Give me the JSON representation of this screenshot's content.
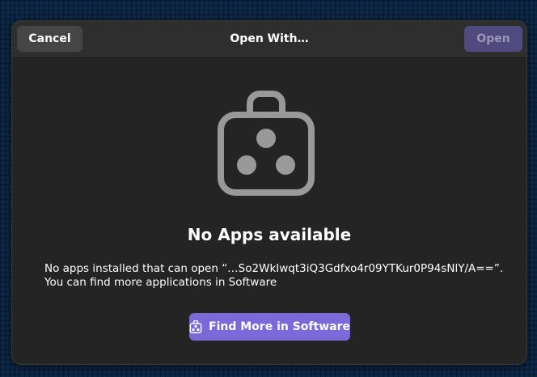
{
  "dialog": {
    "title": "Open With…",
    "cancel_label": "Cancel",
    "open_label": "Open",
    "heading": "No Apps available",
    "message_line1": "No apps installed that can open “…So2WkIwqt3iQ3Gdfxo4r09YTKur0P94sNlY/A==”.",
    "message_line2": "You can find more applications in Software",
    "find_button_label": "Find More in Software"
  },
  "icons": {
    "large": "software-bag-icon",
    "button": "software-bag-icon"
  },
  "colors": {
    "dialog_bg": "#242424",
    "headerbar_bg": "#2e2e2e",
    "accent": "#7b68d9",
    "open_disabled": "#514a7e"
  }
}
